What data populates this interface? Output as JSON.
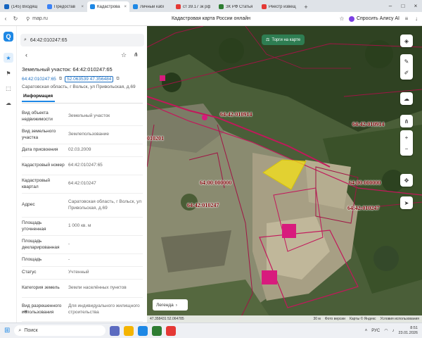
{
  "browser": {
    "tabs": [
      {
        "label": "(145) Входящ",
        "color": "#1565c0"
      },
      {
        "label": "Предостав",
        "color": "#3b82f6"
      },
      {
        "label": "Кадастрова",
        "color": "#1e88e5"
      },
      {
        "label": "Личный кабі",
        "color": "#1e88e5"
      },
      {
        "label": "ст 39.17 зк рф",
        "color": "#e53935"
      },
      {
        "label": "ЗК РФ Статья",
        "color": "#2e7d32"
      },
      {
        "label": "Реестр извещ",
        "color": "#e53935"
      }
    ],
    "url": "map.ru",
    "page_title": "Кадастровая карта России онлайн",
    "alice_label": "Спросить Алису AI"
  },
  "panel": {
    "search_value": "64:42:010247:65",
    "title": "Земельный участок: 64:42:010247:65",
    "id_link": "64:42:010247:65",
    "coords": "52.063539 47.356484",
    "address_line": "Саратовская область, г Вольск, ул Привольская, д.69",
    "tab_label": "Информация",
    "rows": [
      {
        "k": "Вид объекта недвижимости",
        "v": "Земельный участок"
      },
      {
        "k": "Вид земельного участка",
        "v": "Землепользование"
      },
      {
        "k": "Дата присвоения",
        "v": "02.03.2009"
      },
      {
        "k": "Кадастровый номер",
        "v": "64:42:010247:65"
      },
      {
        "k": "Кадастровый квартал",
        "v": "64:42:010247"
      },
      {
        "k": "Адрес",
        "v": "Саратовская область, г Вольск, ул Привольская, д.69"
      },
      {
        "k": "Площадь уточненная",
        "v": "1 000 кв. м"
      },
      {
        "k": "Площадь декларированная",
        "v": "-"
      },
      {
        "k": "Площадь",
        "v": "-"
      },
      {
        "k": "Статус",
        "v": "Учтенный"
      },
      {
        "k": "Категория земель",
        "v": "Земли населённых пунктов"
      },
      {
        "k": "Вид разрешенного использования",
        "v": "Для индивидуального жилищного строительства"
      }
    ]
  },
  "map": {
    "torgi_label": "Торги на карте",
    "labels": {
      "l1": "64:42:010914",
      "l2": "64:42:010914",
      "l3": "010201",
      "l4": "64:00:000000",
      "l5": "64:00:000000",
      "l6": "64:42:010247",
      "l7": "64:42:010247"
    },
    "legend_label": "Легенда",
    "coord_readout": "47.358431 52.064785",
    "scale_label": "30 м",
    "bottom_links": [
      "Фото версии",
      "Карты © Яндекс",
      "Условия использования"
    ]
  },
  "taskbar": {
    "search_label": "Поиск",
    "lang": "РУС",
    "time": "8:51",
    "date": "23.01.2026"
  },
  "colors": {
    "accent": "#1e88e5",
    "parcel_highlight": "#f5e216",
    "boundary": "#c2185b",
    "cadastral_text": "#7a0000"
  }
}
